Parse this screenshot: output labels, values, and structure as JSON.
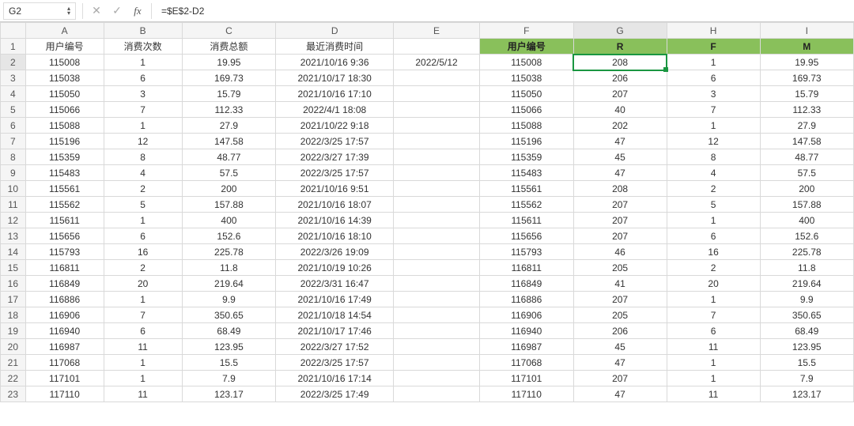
{
  "namebox": "G2",
  "formula_value": "=$E$2-D2",
  "active_cell": {
    "row": 2,
    "col": "G",
    "colIndex": 7,
    "rowIndex": 2
  },
  "col_widths": {
    "corner": 32,
    "A": 100,
    "B": 100,
    "C": 120,
    "D": 150,
    "E": 110,
    "F": 120,
    "G": 120,
    "H": 120,
    "I": 120
  },
  "columns": [
    "A",
    "B",
    "C",
    "D",
    "E",
    "F",
    "G",
    "H",
    "I"
  ],
  "headers": {
    "A": "用户编号",
    "B": "消费次数",
    "C": "消费总额",
    "D": "最近消费时间",
    "E": "",
    "F": "用户编号",
    "G": "R",
    "H": "F",
    "I": "M"
  },
  "green_cols": [
    "F",
    "G",
    "H",
    "I"
  ],
  "e2_value": "2022/5/12",
  "chart_data": {
    "type": "table",
    "columns": [
      "用户编号",
      "消费次数",
      "消费总额",
      "最近消费时间",
      "E",
      "用户编号",
      "R",
      "F",
      "M"
    ],
    "rows": [
      [
        "115008",
        "1",
        "19.95",
        "2021/10/16 9:36",
        "2022/5/12",
        "115008",
        "208",
        "1",
        "19.95"
      ],
      [
        "115038",
        "6",
        "169.73",
        "2021/10/17 18:30",
        "",
        "115038",
        "206",
        "6",
        "169.73"
      ],
      [
        "115050",
        "3",
        "15.79",
        "2021/10/16 17:10",
        "",
        "115050",
        "207",
        "3",
        "15.79"
      ],
      [
        "115066",
        "7",
        "112.33",
        "2022/4/1 18:08",
        "",
        "115066",
        "40",
        "7",
        "112.33"
      ],
      [
        "115088",
        "1",
        "27.9",
        "2021/10/22 9:18",
        "",
        "115088",
        "202",
        "1",
        "27.9"
      ],
      [
        "115196",
        "12",
        "147.58",
        "2022/3/25 17:57",
        "",
        "115196",
        "47",
        "12",
        "147.58"
      ],
      [
        "115359",
        "8",
        "48.77",
        "2022/3/27 17:39",
        "",
        "115359",
        "45",
        "8",
        "48.77"
      ],
      [
        "115483",
        "4",
        "57.5",
        "2022/3/25 17:57",
        "",
        "115483",
        "47",
        "4",
        "57.5"
      ],
      [
        "115561",
        "2",
        "200",
        "2021/10/16 9:51",
        "",
        "115561",
        "208",
        "2",
        "200"
      ],
      [
        "115562",
        "5",
        "157.88",
        "2021/10/16 18:07",
        "",
        "115562",
        "207",
        "5",
        "157.88"
      ],
      [
        "115611",
        "1",
        "400",
        "2021/10/16 14:39",
        "",
        "115611",
        "207",
        "1",
        "400"
      ],
      [
        "115656",
        "6",
        "152.6",
        "2021/10/16 18:10",
        "",
        "115656",
        "207",
        "6",
        "152.6"
      ],
      [
        "115793",
        "16",
        "225.78",
        "2022/3/26 19:09",
        "",
        "115793",
        "46",
        "16",
        "225.78"
      ],
      [
        "116811",
        "2",
        "11.8",
        "2021/10/19 10:26",
        "",
        "116811",
        "205",
        "2",
        "11.8"
      ],
      [
        "116849",
        "20",
        "219.64",
        "2022/3/31 16:47",
        "",
        "116849",
        "41",
        "20",
        "219.64"
      ],
      [
        "116886",
        "1",
        "9.9",
        "2021/10/16 17:49",
        "",
        "116886",
        "207",
        "1",
        "9.9"
      ],
      [
        "116906",
        "7",
        "350.65",
        "2021/10/18 14:54",
        "",
        "116906",
        "205",
        "7",
        "350.65"
      ],
      [
        "116940",
        "6",
        "68.49",
        "2021/10/17 17:46",
        "",
        "116940",
        "206",
        "6",
        "68.49"
      ],
      [
        "116987",
        "11",
        "123.95",
        "2022/3/27 17:52",
        "",
        "116987",
        "45",
        "11",
        "123.95"
      ],
      [
        "117068",
        "1",
        "15.5",
        "2022/3/25 17:57",
        "",
        "117068",
        "47",
        "1",
        "15.5"
      ],
      [
        "117101",
        "1",
        "7.9",
        "2021/10/16 17:14",
        "",
        "117101",
        "207",
        "1",
        "7.9"
      ],
      [
        "117110",
        "11",
        "123.17",
        "2022/3/25 17:49",
        "",
        "117110",
        "47",
        "11",
        "123.17"
      ]
    ]
  }
}
